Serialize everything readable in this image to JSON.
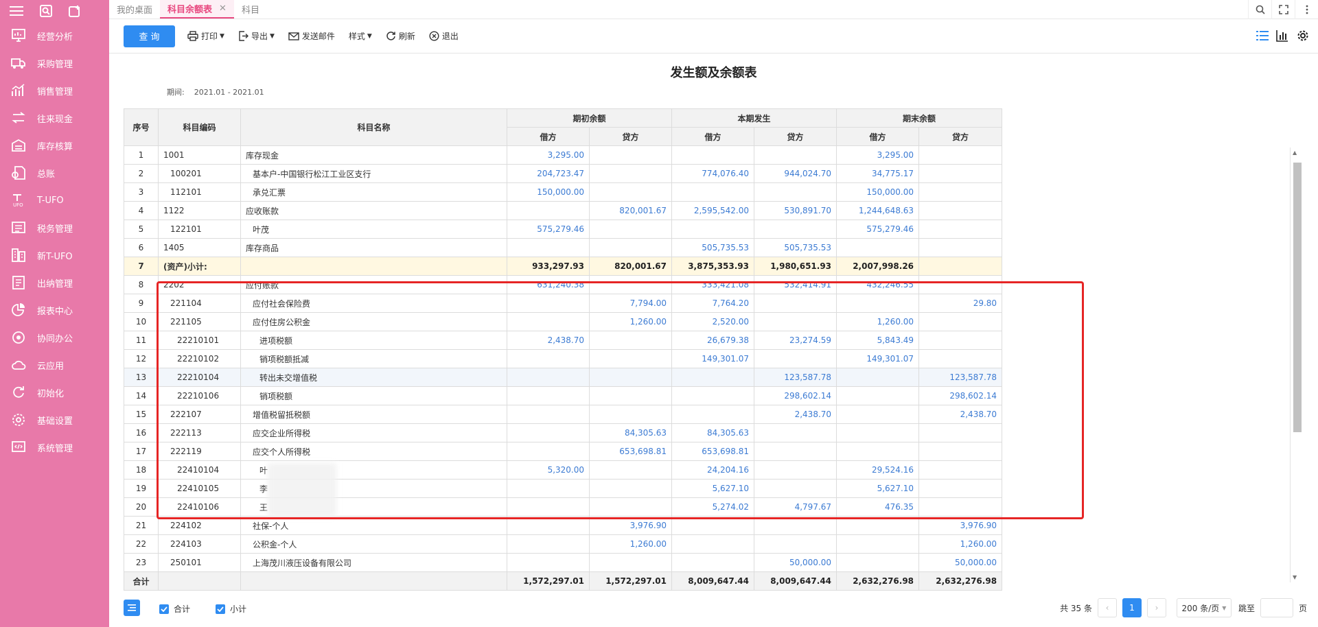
{
  "sidebar": {
    "items": [
      {
        "label": "经营分析",
        "icon": "chart-board-icon"
      },
      {
        "label": "采购管理",
        "icon": "truck-icon"
      },
      {
        "label": "销售管理",
        "icon": "sales-chart-icon"
      },
      {
        "label": "往来现金",
        "icon": "exchange-icon"
      },
      {
        "label": "库存核算",
        "icon": "warehouse-icon"
      },
      {
        "label": "总账",
        "icon": "ledger-icon"
      },
      {
        "label": "T-UFO",
        "icon": "t-ufo-icon"
      },
      {
        "label": "税务管理",
        "icon": "tax-icon"
      },
      {
        "label": "新T-UFO",
        "icon": "new-t-ufo-icon"
      },
      {
        "label": "出纳管理",
        "icon": "cashier-icon"
      },
      {
        "label": "报表中心",
        "icon": "pie-chart-icon"
      },
      {
        "label": "协同办公",
        "icon": "collaboration-icon"
      },
      {
        "label": "云应用",
        "icon": "cloud-icon"
      },
      {
        "label": "初始化",
        "icon": "refresh-icon"
      },
      {
        "label": "基础设置",
        "icon": "settings-icon"
      },
      {
        "label": "系统管理",
        "icon": "system-icon"
      }
    ]
  },
  "tabs": [
    {
      "label": "我的桌面"
    },
    {
      "label": "科目余额表",
      "close": "✕"
    },
    {
      "label": "科目"
    }
  ],
  "toolbar": {
    "query": "查 询",
    "print": "打印",
    "export": "导出",
    "send_mail": "发送邮件",
    "style": "样式",
    "refresh": "刷新",
    "exit": "退出"
  },
  "report": {
    "title": "发生额及余额表",
    "period_label": "期间:",
    "period_value": "2021.01 - 2021.01"
  },
  "table": {
    "headers": {
      "seq": "序号",
      "code": "科目编码",
      "name": "科目名称",
      "opening": "期初余额",
      "current": "本期发生",
      "closing": "期末余额",
      "debit": "借方",
      "credit": "贷方"
    },
    "rows": [
      {
        "seq": "1",
        "code": "1001",
        "name": "库存现金",
        "od": "3,295.00",
        "oc": "",
        "cd": "",
        "cc": "",
        "ed": "3,295.00",
        "ec": ""
      },
      {
        "seq": "2",
        "code": "100201",
        "name": "基本户-中国银行松江工业区支行",
        "od": "204,723.47",
        "oc": "",
        "cd": "774,076.40",
        "cc": "944,024.70",
        "ed": "34,775.17",
        "ec": ""
      },
      {
        "seq": "3",
        "code": "112101",
        "name": "承兑汇票",
        "od": "150,000.00",
        "oc": "",
        "cd": "",
        "cc": "",
        "ed": "150,000.00",
        "ec": ""
      },
      {
        "seq": "4",
        "code": "1122",
        "name": "应收账款",
        "od": "",
        "oc": "820,001.67",
        "cd": "2,595,542.00",
        "cc": "530,891.70",
        "ed": "1,244,648.63",
        "ec": ""
      },
      {
        "seq": "5",
        "code": "122101",
        "name": "叶茂",
        "od": "575,279.46",
        "oc": "",
        "cd": "",
        "cc": "",
        "ed": "575,279.46",
        "ec": ""
      },
      {
        "seq": "6",
        "code": "1405",
        "name": "库存商品",
        "od": "",
        "oc": "",
        "cd": "505,735.53",
        "cc": "505,735.53",
        "ed": "",
        "ec": ""
      },
      {
        "seq": "7",
        "code": "(资产)小计:",
        "name": "",
        "od": "933,297.93",
        "oc": "820,001.67",
        "cd": "3,875,353.93",
        "cc": "1,980,651.93",
        "ed": "2,007,998.26",
        "ec": ""
      },
      {
        "seq": "8",
        "code": "2202",
        "name": "应付账款",
        "od": "631,240.38",
        "oc": "",
        "cd": "333,421.08",
        "cc": "532,414.91",
        "ed": "432,246.55",
        "ec": ""
      },
      {
        "seq": "9",
        "code": "221104",
        "name": "应付社会保险费",
        "od": "",
        "oc": "7,794.00",
        "cd": "7,764.20",
        "cc": "",
        "ed": "",
        "ec": "29.80"
      },
      {
        "seq": "10",
        "code": "221105",
        "name": "应付住房公积金",
        "od": "",
        "oc": "1,260.00",
        "cd": "2,520.00",
        "cc": "",
        "ed": "1,260.00",
        "ec": ""
      },
      {
        "seq": "11",
        "code": "22210101",
        "name": "进项税额",
        "od": "2,438.70",
        "oc": "",
        "cd": "26,679.38",
        "cc": "23,274.59",
        "ed": "5,843.49",
        "ec": ""
      },
      {
        "seq": "12",
        "code": "22210102",
        "name": "销项税额抵减",
        "od": "",
        "oc": "",
        "cd": "149,301.07",
        "cc": "",
        "ed": "149,301.07",
        "ec": ""
      },
      {
        "seq": "13",
        "code": "22210104",
        "name": "转出未交增值税",
        "od": "",
        "oc": "",
        "cd": "",
        "cc": "123,587.78",
        "ed": "",
        "ec": "123,587.78"
      },
      {
        "seq": "14",
        "code": "22210106",
        "name": "销项税额",
        "od": "",
        "oc": "",
        "cd": "",
        "cc": "298,602.14",
        "ed": "",
        "ec": "298,602.14"
      },
      {
        "seq": "15",
        "code": "222107",
        "name": "增值税留抵税额",
        "od": "",
        "oc": "",
        "cd": "",
        "cc": "2,438.70",
        "ed": "",
        "ec": "2,438.70"
      },
      {
        "seq": "16",
        "code": "222113",
        "name": "应交企业所得税",
        "od": "",
        "oc": "84,305.63",
        "cd": "84,305.63",
        "cc": "",
        "ed": "",
        "ec": ""
      },
      {
        "seq": "17",
        "code": "222119",
        "name": "应交个人所得税",
        "od": "",
        "oc": "653,698.81",
        "cd": "653,698.81",
        "cc": "",
        "ed": "",
        "ec": ""
      },
      {
        "seq": "18",
        "code": "22410104",
        "name": "叶",
        "od": "5,320.00",
        "oc": "",
        "cd": "24,204.16",
        "cc": "",
        "ed": "29,524.16",
        "ec": ""
      },
      {
        "seq": "19",
        "code": "22410105",
        "name": "李",
        "od": "",
        "oc": "",
        "cd": "5,627.10",
        "cc": "",
        "ed": "5,627.10",
        "ec": ""
      },
      {
        "seq": "20",
        "code": "22410106",
        "name": "王",
        "od": "",
        "oc": "",
        "cd": "5,274.02",
        "cc": "4,797.67",
        "ed": "476.35",
        "ec": ""
      },
      {
        "seq": "21",
        "code": "224102",
        "name": "社保-个人",
        "od": "",
        "oc": "3,976.90",
        "cd": "",
        "cc": "",
        "ed": "",
        "ec": "3,976.90"
      },
      {
        "seq": "22",
        "code": "224103",
        "name": "公积金-个人",
        "od": "",
        "oc": "1,260.00",
        "cd": "",
        "cc": "",
        "ed": "",
        "ec": "1,260.00"
      },
      {
        "seq": "23",
        "code": "250101",
        "name": "上海茂川液压设备有限公司",
        "od": "",
        "oc": "",
        "cd": "",
        "cc": "50,000.00",
        "ed": "",
        "ec": "50,000.00"
      }
    ],
    "total": {
      "label": "合计",
      "od": "1,572,297.01",
      "oc": "1,572,297.01",
      "cd": "8,009,647.44",
      "cc": "8,009,647.44",
      "ed": "2,632,276.98",
      "ec": "2,632,276.98"
    }
  },
  "footer": {
    "total_checkbox": "合计",
    "subtotal_checkbox": "小计",
    "count": "共 35 条",
    "current_page": "1",
    "page_size": "200 条/页",
    "jump_label": "跳至",
    "page_unit": "页"
  },
  "colors": {
    "sidebar": "#e879a9",
    "accent": "#e8477f",
    "primary": "#2f8cf1",
    "amount": "#3c7bd3",
    "highlight": "#e62525"
  }
}
